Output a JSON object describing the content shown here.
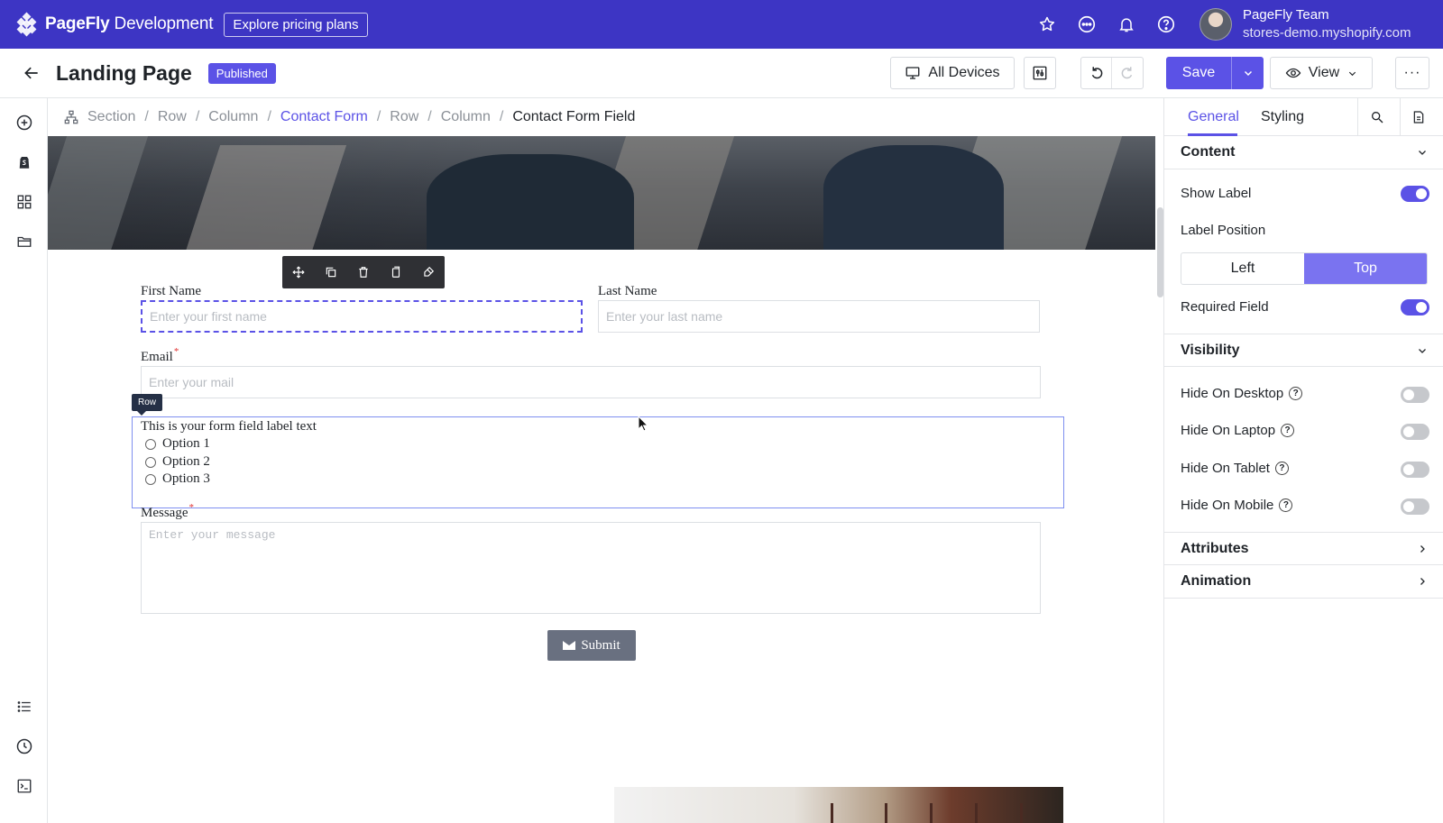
{
  "topbar": {
    "brand_bold": "PageFly",
    "brand_rest": " Development",
    "pricing_label": "Explore pricing plans",
    "icons": [
      "star-icon",
      "chat-icon",
      "bell-icon",
      "help-icon"
    ],
    "user_name": "PageFly Team",
    "user_store": "stores-demo.myshopify.com"
  },
  "header": {
    "title": "Landing Page",
    "status_badge": "Published",
    "devices_label": "All Devices",
    "save_label": "Save",
    "view_label": "View",
    "more_label": "···"
  },
  "breadcrumb": {
    "items": [
      "Section",
      "Row",
      "Column",
      "Contact Form",
      "Row",
      "Column",
      "Contact Form Field"
    ],
    "separator": "/"
  },
  "form": {
    "first_name_label": "First Name",
    "first_name_placeholder": "Enter your first name",
    "last_name_label": "Last Name",
    "last_name_placeholder": "Enter your last name",
    "email_label": "Email",
    "email_placeholder": "Enter your mail",
    "row_tag": "Row",
    "radio_label": "This is your form field label text",
    "options": [
      "Option 1",
      "Option 2",
      "Option 3"
    ],
    "message_label": "Message",
    "message_placeholder": "Enter your message",
    "required_mark": "*",
    "submit_label": "Submit"
  },
  "right_panel": {
    "tabs": [
      "General",
      "Styling"
    ],
    "content": {
      "title": "Content",
      "show_label": "Show Label",
      "show_label_on": true,
      "label_position": "Label Position",
      "position_options": [
        "Left",
        "Top"
      ],
      "position_selected": "Top",
      "required_field": "Required Field",
      "required_on": true
    },
    "visibility": {
      "title": "Visibility",
      "items": [
        {
          "label": "Hide On Desktop",
          "on": false
        },
        {
          "label": "Hide On Laptop",
          "on": false
        },
        {
          "label": "Hide On Tablet",
          "on": false
        },
        {
          "label": "Hide On Mobile",
          "on": false
        }
      ]
    },
    "attributes_title": "Attributes",
    "animation_title": "Animation"
  },
  "colors": {
    "brand": "#3d35c4",
    "accent": "#5b52e6",
    "toggle_off": "#c6c8cc"
  }
}
